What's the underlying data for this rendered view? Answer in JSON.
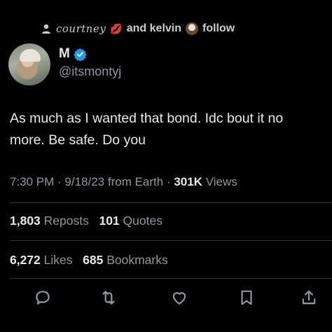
{
  "social_context": {
    "name": "courtney",
    "emoji": "💋",
    "middle": "and kelvin",
    "suffix": "follow"
  },
  "author": {
    "display_name": "M",
    "handle": "@itsmontyj"
  },
  "tweet": {
    "text": "As much as I wanted that bond. Idc bout it no\nmore. Be safe. Do you"
  },
  "meta": {
    "time_date": "7:30 PM · 9/18/23 from Earth ·",
    "views_count": "301K",
    "views_label": "Views"
  },
  "stats": {
    "reposts_count": "1,803",
    "reposts_label": "Reposts",
    "quotes_count": "101",
    "quotes_label": "Quotes",
    "likes_count": "6,272",
    "likes_label": "Likes",
    "bookmarks_count": "685",
    "bookmarks_label": "Bookmarks"
  },
  "actions": [
    "reply-icon",
    "repost-icon",
    "like-icon",
    "bookmark-icon",
    "share-icon"
  ],
  "colors": {
    "background": "#000000",
    "text": "#e7e9ea",
    "secondary": "#8b98a5",
    "verified": "#1d9bf0",
    "divider": "#2f3336"
  }
}
